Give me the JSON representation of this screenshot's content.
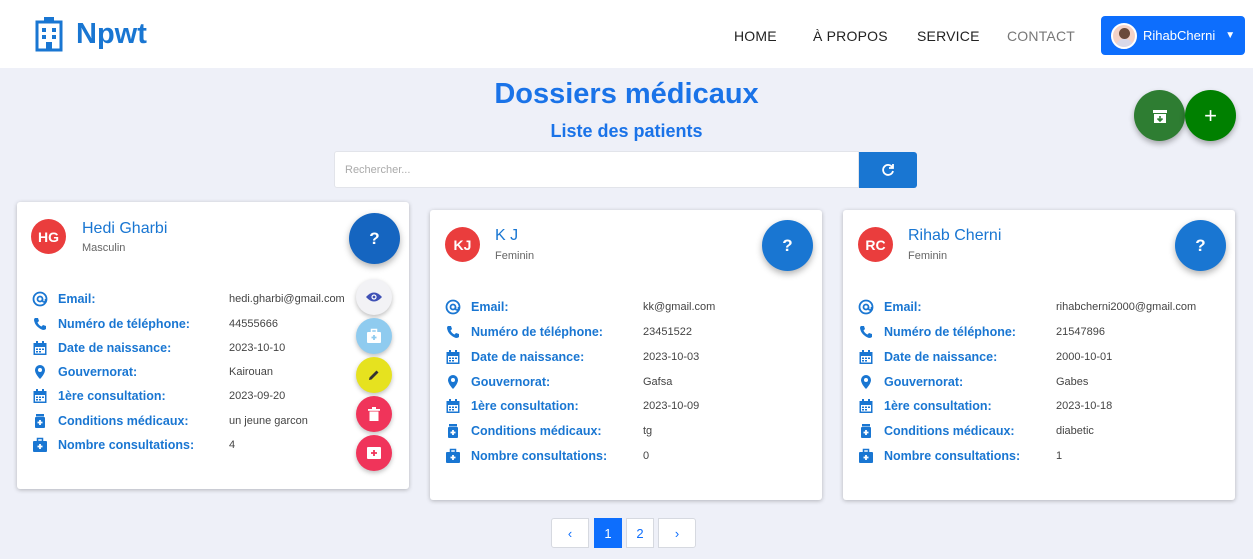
{
  "header": {
    "brand": "Npwt",
    "nav": [
      "HOME",
      "À PROPOS",
      "SERVICE",
      "CONTACT"
    ],
    "user": "RihabCherni"
  },
  "page": {
    "title": "Dossiers médicaux",
    "subtitle": "Liste des patients"
  },
  "search": {
    "placeholder": "Rechercher..."
  },
  "labels": {
    "email": "Email:",
    "phone": "Numéro de téléphone:",
    "birth": "Date de naissance:",
    "region": "Gouvernorat:",
    "first_consult": "1ère consultation:",
    "conditions": "Conditions médicaux:",
    "consults": "Nombre consultations:"
  },
  "help_label": "?",
  "patients": [
    {
      "initials": "HG",
      "name": "Hedi Gharbi",
      "gender": "Masculin",
      "email": "hedi.gharbi@gmail.com",
      "phone": "44555666",
      "birth": "2023-10-10",
      "region": "Kairouan",
      "first_consult": "2023-09-20",
      "conditions": "un jeune garcon",
      "consults": "4"
    },
    {
      "initials": "KJ",
      "name": "K J",
      "gender": "Feminin",
      "email": "kk@gmail.com",
      "phone": "23451522",
      "birth": "2023-10-03",
      "region": "Gafsa",
      "first_consult": "2023-10-09",
      "conditions": "tg",
      "consults": "0"
    },
    {
      "initials": "RC",
      "name": "Rihab Cherni",
      "gender": "Feminin",
      "email": "rihabcherni2000@gmail.com",
      "phone": "21547896",
      "birth": "2000-10-01",
      "region": "Gabes",
      "first_consult": "2023-10-18",
      "conditions": "diabetic",
      "consults": "1"
    }
  ],
  "pagination": {
    "pages": [
      "1",
      "2"
    ],
    "current": "1"
  },
  "colors": {
    "primary": "#1976d2",
    "accent_red": "#ea3d3d",
    "green": "#2e7d32"
  }
}
